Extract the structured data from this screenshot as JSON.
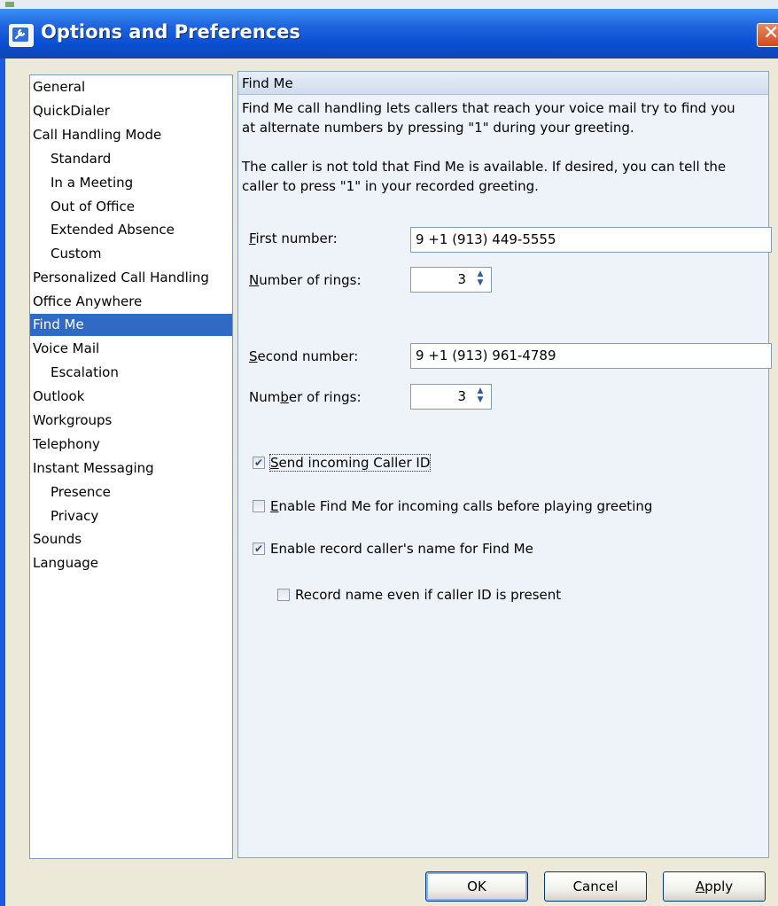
{
  "window": {
    "title": "Options and Preferences",
    "title_icon": "options-wrench-icon",
    "close_icon": "close-icon"
  },
  "nav": {
    "items": [
      {
        "label": "General",
        "level": 0
      },
      {
        "label": "QuickDialer",
        "level": 0
      },
      {
        "label": "Call Handling Mode",
        "level": 0
      },
      {
        "label": "Standard",
        "level": 1
      },
      {
        "label": "In a Meeting",
        "level": 1
      },
      {
        "label": "Out of Office",
        "level": 1
      },
      {
        "label": "Extended Absence",
        "level": 1
      },
      {
        "label": "Custom",
        "level": 1
      },
      {
        "label": "Personalized Call Handling",
        "level": 0
      },
      {
        "label": "Office Anywhere",
        "level": 0
      },
      {
        "label": "Find Me",
        "level": 0,
        "selected": true
      },
      {
        "label": "Voice Mail",
        "level": 0
      },
      {
        "label": "Escalation",
        "level": 1
      },
      {
        "label": "Outlook",
        "level": 0
      },
      {
        "label": "Workgroups",
        "level": 0
      },
      {
        "label": "Telephony",
        "level": 0
      },
      {
        "label": "Instant Messaging",
        "level": 0
      },
      {
        "label": "Presence",
        "level": 1
      },
      {
        "label": "Privacy",
        "level": 1
      },
      {
        "label": "Sounds",
        "level": 0
      },
      {
        "label": "Language",
        "level": 0
      }
    ]
  },
  "panel": {
    "header": "Find Me",
    "desc1_line1": "Find Me call handling lets callers that reach your voice mail try to find you",
    "desc1_line2": "at alternate numbers by pressing \"1\" during your greeting.",
    "desc2_line1": "The caller is not told that Find Me is available. If desired, you can tell the",
    "desc2_line2": "caller to press \"1\" in your recorded greeting.",
    "first_number": {
      "label_key": "F",
      "label_rest": "irst number:",
      "value": "9 +1 (913) 449-5555"
    },
    "first_rings": {
      "label_key": "N",
      "label_rest": "umber of rings:",
      "value": "3"
    },
    "second_number": {
      "label_key": "S",
      "label_rest": "econd number:",
      "value": "9 +1 (913) 961-4789"
    },
    "second_rings": {
      "label_pre": "Num",
      "label_key": "b",
      "label_rest": "er of rings:",
      "value": "3"
    },
    "send_caller_id": {
      "label_key": "S",
      "label_rest": "end incoming Caller ID",
      "checked": true
    },
    "enable_before_greeting": {
      "label_key": "E",
      "label_rest": "nable Find Me for incoming calls before playing greeting",
      "checked": false
    },
    "enable_record_name": {
      "label": "Enable record caller's name for Find Me",
      "checked": true
    },
    "record_even_if_id": {
      "label": "Record name even if caller ID is present",
      "checked": false
    }
  },
  "buttons": {
    "ok": "OK",
    "cancel": "Cancel",
    "apply_key": "A",
    "apply_rest": "pply"
  },
  "colors": {
    "titlebar": "#0a4fd2",
    "selection": "#316ac5",
    "dialog_bg": "#ece9d8",
    "panel_bg": "#eef3fa"
  }
}
